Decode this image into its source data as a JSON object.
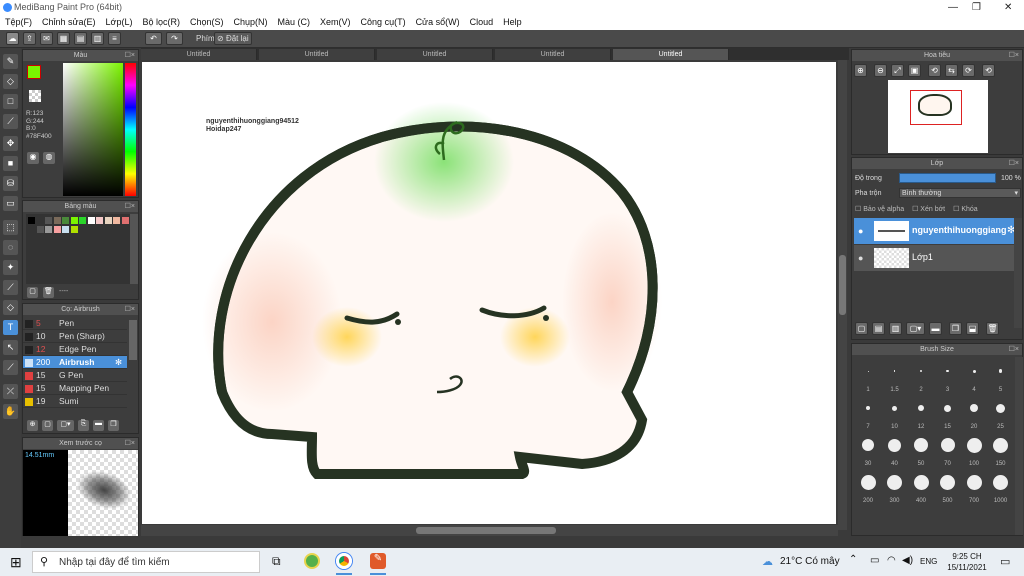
{
  "app": {
    "title": "MediBang Paint Pro (64bit)"
  },
  "menu": [
    "Tệp(F)",
    "Chỉnh sửa(E)",
    "Lớp(L)",
    "Bộ lọc(R)",
    "Chọn(S)",
    "Chụp(N)",
    "Màu (C)",
    "Xem(V)",
    "Công cụ(T)",
    "Cửa sổ(W)",
    "Cloud",
    "Help"
  ],
  "toolbar": {
    "phim_label": "Phím",
    "reset_label": "Đặt lại"
  },
  "color_panel": {
    "title": "Màu",
    "r": "R:123",
    "g": "G:244",
    "b": "B:0",
    "hex": "#78F400",
    "fg_color": "#7bf400"
  },
  "palette_panel": {
    "title": "Bảng màu",
    "status": "----"
  },
  "brush_panel": {
    "title": "Cọ: Airbrush",
    "items": [
      {
        "size": "5",
        "name": "Pen",
        "color": "#222222"
      },
      {
        "size": "10",
        "name": "Pen (Sharp)",
        "color": "#222222"
      },
      {
        "size": "12",
        "name": "Edge Pen",
        "color": "#222222"
      },
      {
        "size": "200",
        "name": "Airbrush",
        "color": "#4a90d9"
      },
      {
        "size": "15",
        "name": "G Pen",
        "color": "#e04040"
      },
      {
        "size": "15",
        "name": "Mapping Pen",
        "color": "#e04040"
      },
      {
        "size": "19",
        "name": "Sumi",
        "color": "#e8c000"
      }
    ]
  },
  "preview_panel": {
    "title": "Xem trước cọ",
    "size": "14.51mm"
  },
  "tabs": [
    "Untitled",
    "Untitled",
    "Untitled",
    "Untitled",
    "Untitled"
  ],
  "canvas": {
    "credit_line1": "nguyenthihuonggiang94512",
    "credit_line2": "Hoidap247"
  },
  "navigator_panel": {
    "title": "Hoa tiêu"
  },
  "layer_panel": {
    "title": "Lớp",
    "opacity_label": "Độ trong",
    "opacity_value": "100 %",
    "blend_label": "Pha trộn",
    "blend_value": "Bình thường",
    "protect_alpha": "Bảo vệ alpha",
    "clipping": "Xén bớt",
    "lock": "Khóa",
    "layers": [
      {
        "name": "nguyenthihuonggiang"
      },
      {
        "name": "Lớp1"
      }
    ]
  },
  "brush_size_panel": {
    "title": "Brush Size",
    "sizes": [
      "1",
      "1.5",
      "2",
      "3",
      "4",
      "5",
      "7",
      "10",
      "12",
      "15",
      "20",
      "25",
      "30",
      "40",
      "50",
      "70",
      "100",
      "150",
      "200",
      "300",
      "400",
      "500",
      "700",
      "1000"
    ]
  },
  "taskbar": {
    "search_placeholder": "Nhập tại đây để tìm kiếm",
    "weather": "21°C Có mây",
    "lang": "ENG",
    "time": "9:25 CH",
    "date": "15/11/2021"
  }
}
